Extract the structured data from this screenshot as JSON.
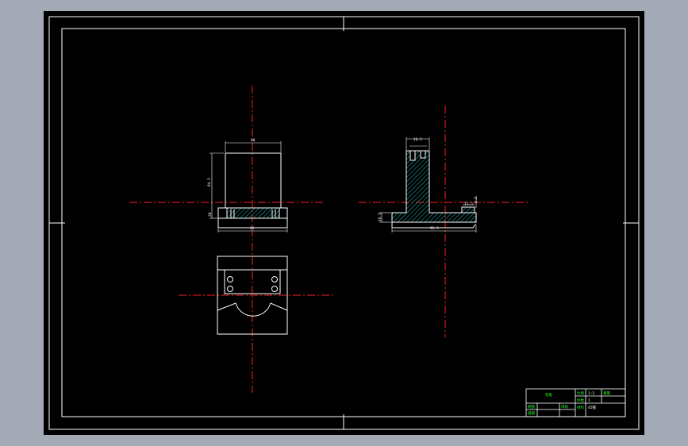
{
  "colors": {
    "background": "#a3aab6",
    "sheet": "#000000",
    "line": "#ffffff",
    "centerline": "#ff2020",
    "hatch": "#22b8b8",
    "titleblock_text": "#22ff22"
  },
  "title_block": {
    "name": "垫板",
    "fields": [
      "比例",
      "件数",
      "重量",
      "材料"
    ],
    "values": [
      "1:2",
      "1",
      "",
      "45钢"
    ],
    "rows": [
      "制图",
      "描图",
      "审核"
    ]
  },
  "dimensions": {
    "front_top": "80",
    "front_left": "84.5",
    "front_small": "20",
    "front_bottom": "95",
    "side_top": "16.5",
    "side_right": "5.5",
    "side_step": "15.5",
    "side_left": "16.5",
    "side_bottom": "95.5"
  }
}
